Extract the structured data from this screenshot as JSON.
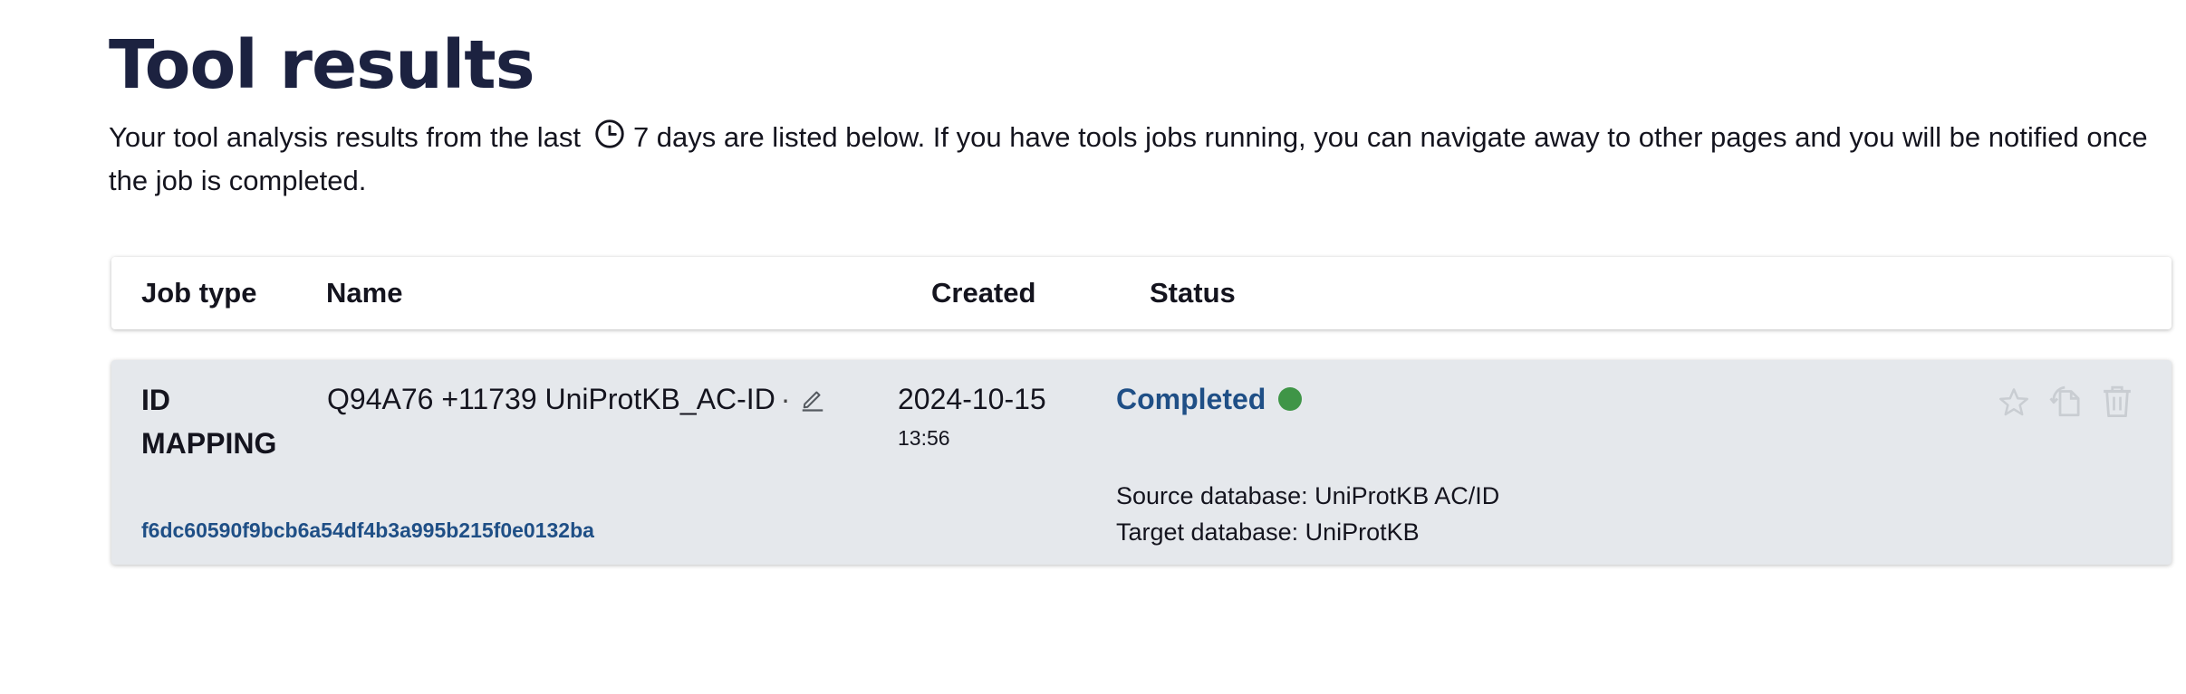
{
  "page": {
    "title": "Tool results",
    "intro_before": "Your tool analysis results from the last",
    "intro_after": "7 days are listed below. If you have tools jobs running, you can navigate away to other pages and you will be notified once the job is completed."
  },
  "table": {
    "headers": {
      "job_type": "Job type",
      "name": "Name",
      "created": "Created",
      "status": "Status"
    },
    "rows": [
      {
        "job_type": "ID MAPPING",
        "name": "Q94A76 +11739 UniProtKB_AC-ID",
        "name_separator": "·",
        "job_id": "f6dc60590f9bcb6a54df4b3a995b215f0e0132ba",
        "created_date": "2024-10-15",
        "created_time": "13:56",
        "status": "Completed",
        "source_database": "Source database: UniProtKB AC/ID",
        "target_database": "Target database: UniProtKB"
      }
    ]
  },
  "icons": {
    "time": "clock-icon",
    "edit": "pencil-icon",
    "status": "status-dot-icon",
    "favourite": "star-icon",
    "resubmit": "resubmit-icon",
    "delete": "trash-icon"
  },
  "colors": {
    "title": "#1c2240",
    "link": "#1f4f86",
    "completed_dot": "#3f9547",
    "row_background": "#e5e8ec",
    "action_icons": "#c7cbd0"
  }
}
